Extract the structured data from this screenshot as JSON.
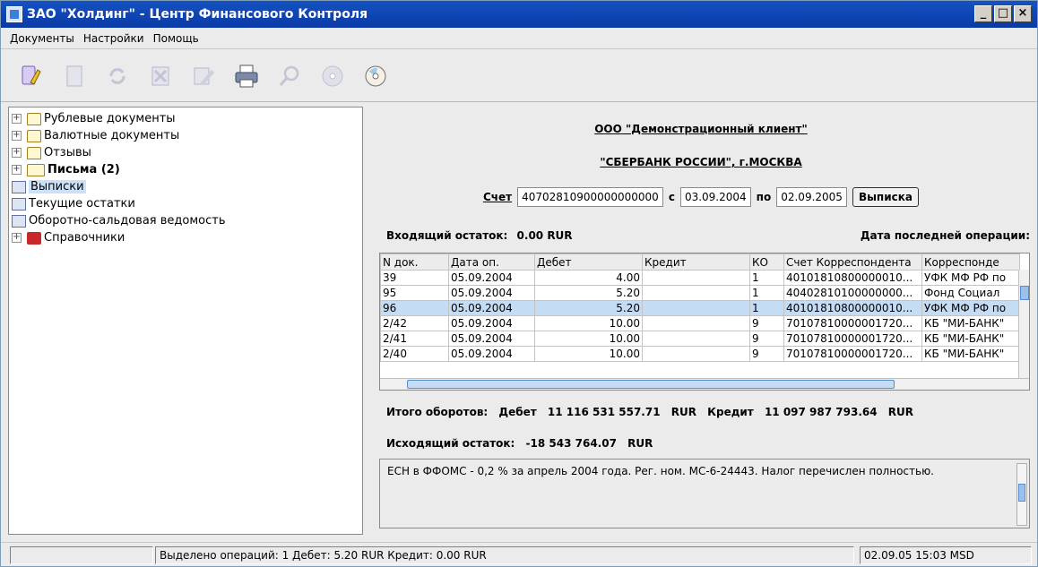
{
  "window": {
    "title": "ЗАО \"Холдинг\" - Центр Финансового Контроля"
  },
  "menu": [
    "Документы",
    "Настройки",
    "Помощь"
  ],
  "toolbar": [
    "key-icon",
    "document-icon",
    "refresh-icon",
    "cancel-icon",
    "edit-icon",
    "print-icon",
    "search-icon",
    "disk-icon",
    "cd-icon"
  ],
  "tree": {
    "items": [
      {
        "label": "Рублевые документы",
        "icon": "folder-icon",
        "expandable": true
      },
      {
        "label": "Валютные документы",
        "icon": "folder-icon",
        "expandable": true
      },
      {
        "label": "Отзывы",
        "icon": "folder-icon",
        "expandable": true
      },
      {
        "label": "Письма (2)",
        "icon": "folder-open-icon",
        "expandable": true,
        "bold": true
      },
      {
        "label": "Выписки",
        "icon": "document-icon",
        "expandable": false,
        "selected": true
      },
      {
        "label": "Текущие остатки",
        "icon": "document-icon",
        "expandable": false
      },
      {
        "label": "Оборотно-сальдовая ведомость",
        "icon": "document-icon",
        "expandable": false
      },
      {
        "label": "Справочники",
        "icon": "book-icon",
        "expandable": true
      }
    ]
  },
  "statement": {
    "client": "ООО \"Демонстрационный клиент\"",
    "bank": "\"СБЕРБАНК РОССИИ\", г.МОСКВА",
    "account_label": "Счет",
    "account": "40702810900000000000",
    "from_label": "с",
    "from_date": "03.09.2004",
    "to_label": "по",
    "to_date": "02.09.2005",
    "button": "Выписка",
    "opening_label": "Входящий остаток:",
    "opening_value": "0.00  RUR",
    "last_op_label": "Дата последней операции:"
  },
  "table": {
    "columns": [
      "N док.",
      "Дата оп.",
      "Дебет",
      "Кредит",
      "КО",
      "Счет Корреспондента",
      "Корреспонде"
    ],
    "rows": [
      [
        "39",
        "05.09.2004",
        "4.00",
        "",
        "1",
        "40101810800000010...",
        "УФК МФ РФ по"
      ],
      [
        "95",
        "05.09.2004",
        "5.20",
        "",
        "1",
        "40402810100000000...",
        "Фонд Социал"
      ],
      [
        "96",
        "05.09.2004",
        "5.20",
        "",
        "1",
        "40101810800000010...",
        "УФК МФ РФ по"
      ],
      [
        "2/42",
        "05.09.2004",
        "10.00",
        "",
        "9",
        "70107810000001720...",
        "КБ \"МИ-БАНК\""
      ],
      [
        "2/41",
        "05.09.2004",
        "10.00",
        "",
        "9",
        "70107810000001720...",
        "КБ \"МИ-БАНК\""
      ],
      [
        "2/40",
        "05.09.2004",
        "10.00",
        "",
        "9",
        "70107810000001720...",
        "КБ \"МИ-БАНК\""
      ]
    ],
    "selected_row": 2
  },
  "totals": {
    "label": "Итого оборотов:",
    "debit_label": "Дебет",
    "debit": "11 116 531 557.71",
    "currency": "RUR",
    "credit_label": "Кредит",
    "credit": "11 097 987 793.64"
  },
  "closing": {
    "label": "Исходящий остаток:",
    "value": "-18 543 764.07",
    "currency": "RUR"
  },
  "note": "ЕСН в ФФОМС - 0,2 % за апрель 2004 года. Рег. ном. МС-6-24443. Налог перечислен полностью.",
  "status": {
    "left": "",
    "selection": "Выделено операций: 1 Дебет: 5.20 RUR Кредит: 0.00 RUR",
    "datetime": "02.09.05 15:03 MSD"
  }
}
